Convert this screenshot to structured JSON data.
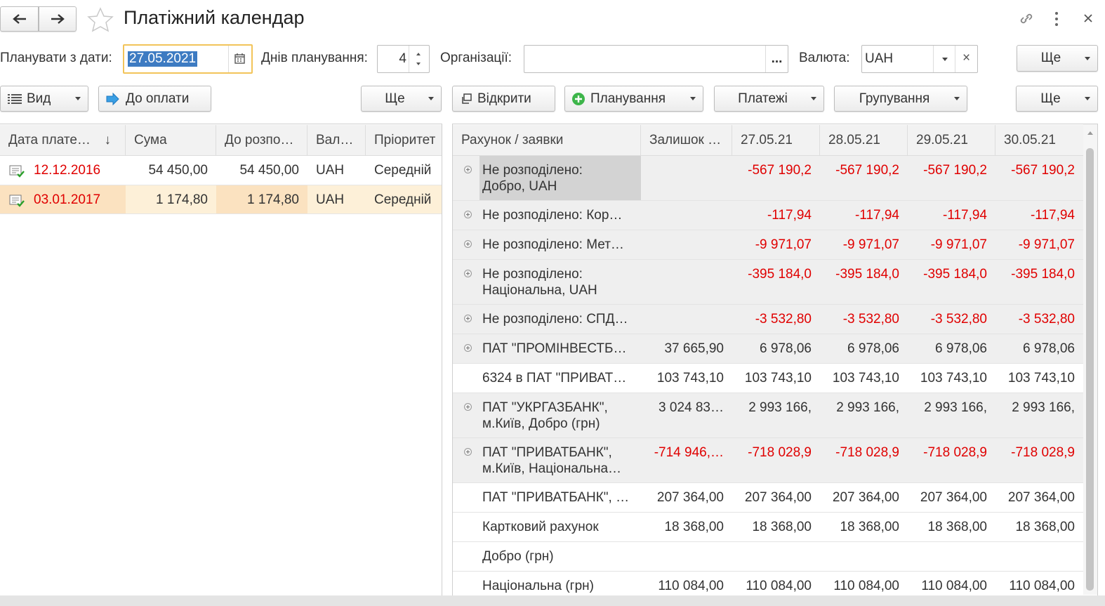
{
  "title": "Платіжний календар",
  "header": {
    "plan_from_label": "Планувати з дати:",
    "plan_from_value": "27.05.2021",
    "days_label": "Днів планування:",
    "days_value": "4",
    "org_label": "Організації:",
    "org_value": "",
    "org_select": "...",
    "currency_label": "Валюта:",
    "currency_value": "UAH",
    "currency_clear": "×",
    "more_label": "Ще"
  },
  "left_toolbar": {
    "view_label": "Вид",
    "to_pay_label": "До оплати",
    "more_label": "Ще"
  },
  "right_toolbar": {
    "open_label": "Відкрити",
    "planning_label": "Планування",
    "payments_label": "Платежі",
    "grouping_label": "Групування",
    "more_label": "Ще"
  },
  "left_table": {
    "columns": [
      "Дата плате…",
      "Сума",
      "До розпо…",
      "Вал…",
      "Пріоритет"
    ],
    "sort_icon": "↓",
    "rows": [
      {
        "date": "12.12.2016",
        "sum": "54 450,00",
        "to_distribute": "54 450,00",
        "currency": "UAH",
        "priority": "Середній"
      },
      {
        "date": "03.01.2017",
        "sum": "1 174,80",
        "to_distribute": "1 174,80",
        "currency": "UAH",
        "priority": "Середній"
      }
    ]
  },
  "right_table": {
    "columns": [
      "Рахунок / заявки",
      "Залишок …",
      "27.05.21",
      "28.05.21",
      "29.05.21",
      "30.05.21"
    ],
    "rows": [
      {
        "name1": "Не розподілено:",
        "name2": "Добро, UAH",
        "balance": "",
        "d1": "-567 190,2",
        "d2": "-567 190,2",
        "d3": "-567 190,2",
        "d4": "-567 190,2"
      },
      {
        "name1": "Не розподілено: Кор…",
        "name2": "",
        "balance": "",
        "d1": "-117,94",
        "d2": "-117,94",
        "d3": "-117,94",
        "d4": "-117,94"
      },
      {
        "name1": "Не розподілено: Мет…",
        "name2": "",
        "balance": "",
        "d1": "-9 971,07",
        "d2": "-9 971,07",
        "d3": "-9 971,07",
        "d4": "-9 971,07"
      },
      {
        "name1": "Не розподілено:",
        "name2": "Національна, UAH",
        "balance": "",
        "d1": "-395 184,0",
        "d2": "-395 184,0",
        "d3": "-395 184,0",
        "d4": "-395 184,0"
      },
      {
        "name1": "Не розподілено: СПД…",
        "name2": "",
        "balance": "",
        "d1": "-3 532,80",
        "d2": "-3 532,80",
        "d3": "-3 532,80",
        "d4": "-3 532,80"
      },
      {
        "name1": "ПАТ \"ПРОМІНВЕСТБ…",
        "name2": "",
        "balance": "37 665,90",
        "d1": "6 978,06",
        "d2": "6 978,06",
        "d3": "6 978,06",
        "d4": "6 978,06"
      },
      {
        "name1": "6324 в ПАТ \"ПРИВАТ…",
        "name2": "",
        "balance": "103 743,10",
        "d1": "103 743,10",
        "d2": "103 743,10",
        "d3": "103 743,10",
        "d4": "103 743,10"
      },
      {
        "name1": "ПАТ \"УКРГАЗБАНК\",",
        "name2": "м.Київ, Добро (грн)",
        "balance": "3 024 83…",
        "d1": "2 993 166,",
        "d2": "2 993 166,",
        "d3": "2 993 166,",
        "d4": "2 993 166,"
      },
      {
        "name1": "ПАТ \"ПРИВАТБАНК\",",
        "name2": "м.Київ, Національна…",
        "balance": "-714 946,…",
        "d1": "-718 028,9",
        "d2": "-718 028,9",
        "d3": "-718 028,9",
        "d4": "-718 028,9"
      },
      {
        "name1": "ПАТ \"ПРИВАТБАНК\", …",
        "name2": "",
        "balance": "207 364,00",
        "d1": "207 364,00",
        "d2": "207 364,00",
        "d3": "207 364,00",
        "d4": "207 364,00"
      },
      {
        "name1": "Картковий рахунок",
        "name2": "",
        "balance": "18 368,00",
        "d1": "18 368,00",
        "d2": "18 368,00",
        "d3": "18 368,00",
        "d4": "18 368,00"
      },
      {
        "name1": "Добро (грн)",
        "name2": "",
        "balance": "",
        "d1": "",
        "d2": "",
        "d3": "",
        "d4": ""
      },
      {
        "name1": "Національна (грн)",
        "name2": "",
        "balance": "110 084,00",
        "d1": "110 084,00",
        "d2": "110 084,00",
        "d3": "110 084,00",
        "d4": "110 084,00"
      }
    ]
  },
  "colors": {
    "negative": "#e00000",
    "selected_row": "#fdf0d8",
    "group_row": "#efefef"
  }
}
